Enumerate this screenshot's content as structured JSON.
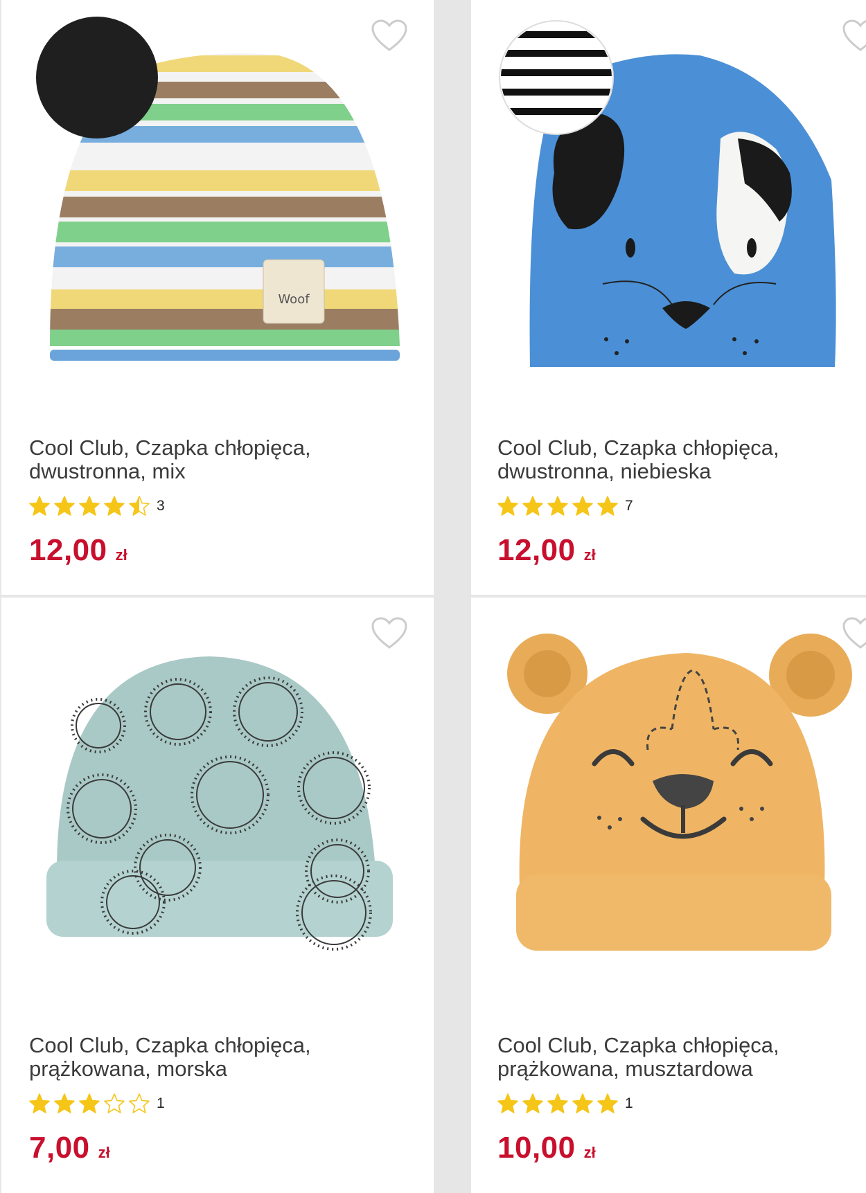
{
  "colors": {
    "price": "#c8102e",
    "star": "#f5c518",
    "card_bg": "#ffffff",
    "divider": "#e6e6e6"
  },
  "products": [
    {
      "title_line1": "Cool Club, Czapka chłopięca,",
      "title_line2": "dwustronna, mix",
      "rating": 4.5,
      "reviews": "3",
      "price": "12,00",
      "currency": "zł",
      "image": "striped-beanie"
    },
    {
      "title_line1": "Cool Club, Czapka chłopięca,",
      "title_line2": "dwustronna, niebieska",
      "rating": 5,
      "reviews": "7",
      "price": "12,00",
      "currency": "zł",
      "image": "blue-dog-beanie"
    },
    {
      "title_line1": "Cool Club, Czapka chłopięca,",
      "title_line2": "prążkowana, morska",
      "rating": 3,
      "reviews": "1",
      "price": "7,00",
      "currency": "zł",
      "image": "lion-print-beanie"
    },
    {
      "title_line1": "Cool Club, Czapka chłopięca,",
      "title_line2": "prążkowana, musztardowa",
      "rating": 5,
      "reviews": "1",
      "price": "10,00",
      "currency": "zł",
      "image": "bear-ears-beanie"
    }
  ]
}
